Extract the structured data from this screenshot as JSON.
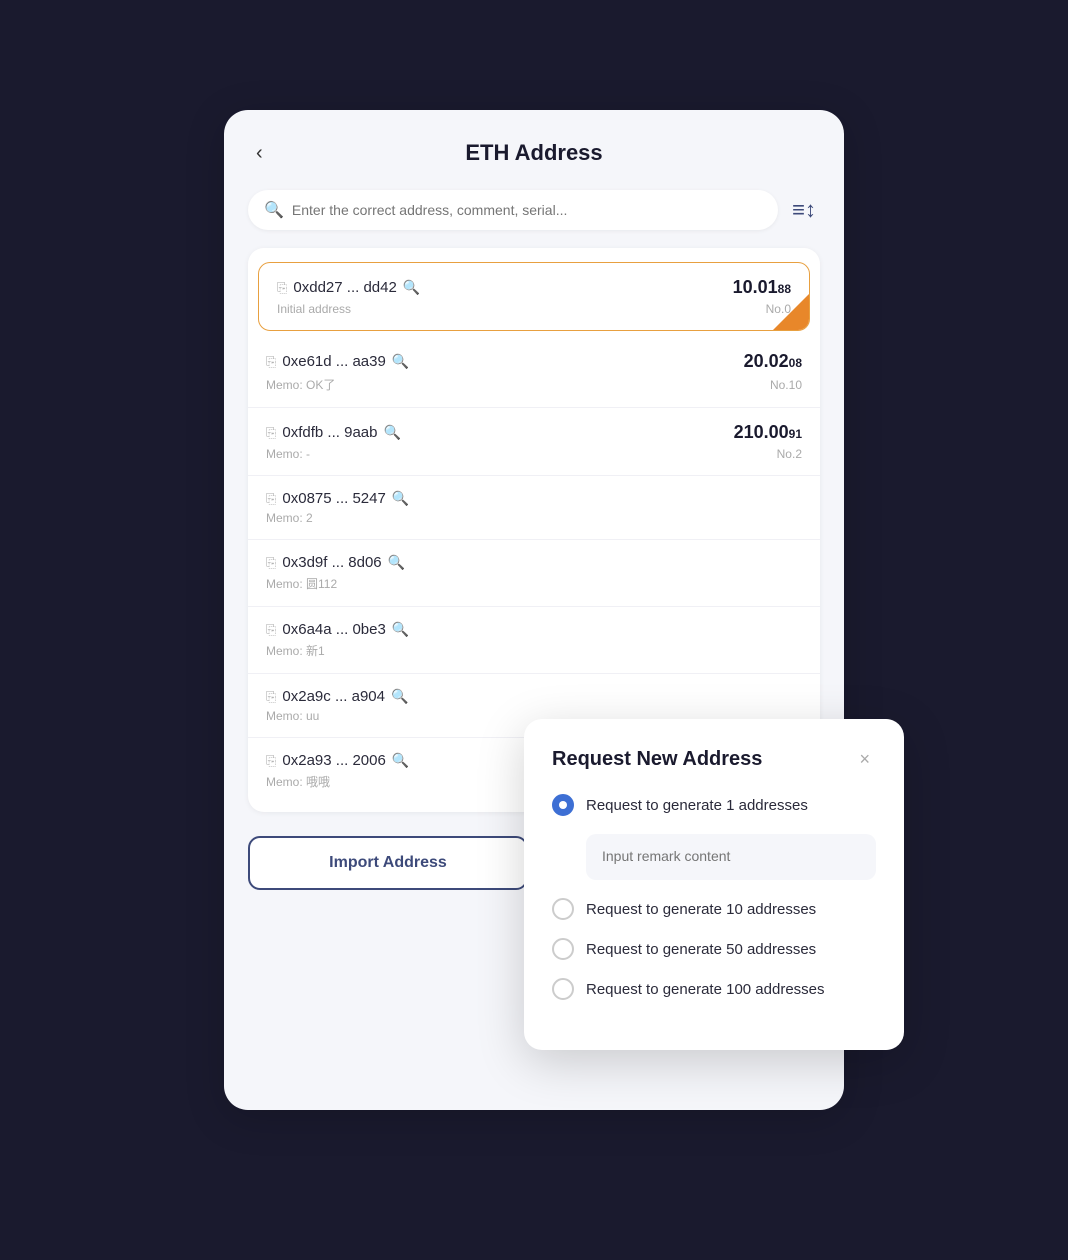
{
  "header": {
    "back_label": "‹",
    "title": "ETH Address"
  },
  "search": {
    "placeholder": "Enter the correct address, comment, serial..."
  },
  "filter_icon": "≡↕",
  "addresses": [
    {
      "address": "0xdd27 ... dd42",
      "memo": "Initial address",
      "amount_main": "10.01",
      "amount_dec": "88",
      "no": "No.0",
      "active": true
    },
    {
      "address": "0xe61d ... aa39",
      "memo": "Memo: OK了",
      "amount_main": "20.02",
      "amount_dec": "08",
      "no": "No.10",
      "active": false
    },
    {
      "address": "0xfdfb ... 9aab",
      "memo": "Memo: -",
      "amount_main": "210.00",
      "amount_dec": "91",
      "no": "No.2",
      "active": false
    },
    {
      "address": "0x0875 ... 5247",
      "memo": "Memo: 2",
      "amount_main": "",
      "amount_dec": "",
      "no": "",
      "active": false
    },
    {
      "address": "0x3d9f ... 8d06",
      "memo": "Memo: 圆112",
      "amount_main": "",
      "amount_dec": "",
      "no": "",
      "active": false
    },
    {
      "address": "0x6a4a ... 0be3",
      "memo": "Memo: 新1",
      "amount_main": "",
      "amount_dec": "",
      "no": "",
      "active": false
    },
    {
      "address": "0x2a9c ... a904",
      "memo": "Memo: uu",
      "amount_main": "",
      "amount_dec": "",
      "no": "",
      "active": false
    },
    {
      "address": "0x2a93 ... 2006",
      "memo": "Memo: 哦哦",
      "amount_main": "",
      "amount_dec": "",
      "no": "",
      "active": false
    }
  ],
  "buttons": {
    "import": "Import Address",
    "request": "Request New Address"
  },
  "modal": {
    "title": "Request New Address",
    "close_label": "×",
    "options": [
      {
        "label": "Request to generate 1 addresses",
        "checked": true
      },
      {
        "label": "Request to generate 10 addresses",
        "checked": false
      },
      {
        "label": "Request to generate 50 addresses",
        "checked": false
      },
      {
        "label": "Request to generate 100 addresses",
        "checked": false
      }
    ],
    "remark_placeholder": "Input remark content"
  }
}
